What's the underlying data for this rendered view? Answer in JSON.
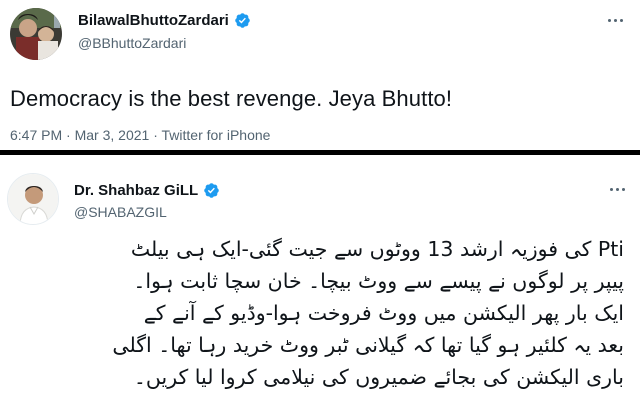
{
  "tweet1": {
    "display_name": "BilawalBhuttoZardari",
    "handle": "@BBhuttoZardari",
    "text": "Democracy is the best revenge. Jeya Bhutto!",
    "time": "6:47 PM",
    "separator": "·",
    "date": "Mar 3, 2021",
    "source": "Twitter for iPhone",
    "verified_color": "#1d9bf0"
  },
  "tweet2": {
    "display_name": "Dr. Shahbaz GiLL",
    "handle": "@SHABAZGIL",
    "text_lines": [
      "Pti کی فوزیہ ارشد 13 ووٹوں سے جیت گئی-ایک ہی بیلٹ",
      "پیپر پر لوگوں نے پیسے سے ووٹ بیچا۔ خان سچا ثابت ہوا۔",
      "ایک بار پھر الیکشن میں ووٹ فروخت ہوا-وڈیو کے آنے کے",
      "بعد یہ کلئیر ہو گیا تھا کہ گیلانی ٹبر ووٹ خرید رہا تھا۔ اگلی",
      "باری الیکشن کی بجائے ضمیروں کی نیلامی کروا لیا کریں۔"
    ],
    "verified_color": "#1d9bf0"
  },
  "icons": {
    "verified": "verified-badge-icon",
    "more": "more-options-icon"
  }
}
